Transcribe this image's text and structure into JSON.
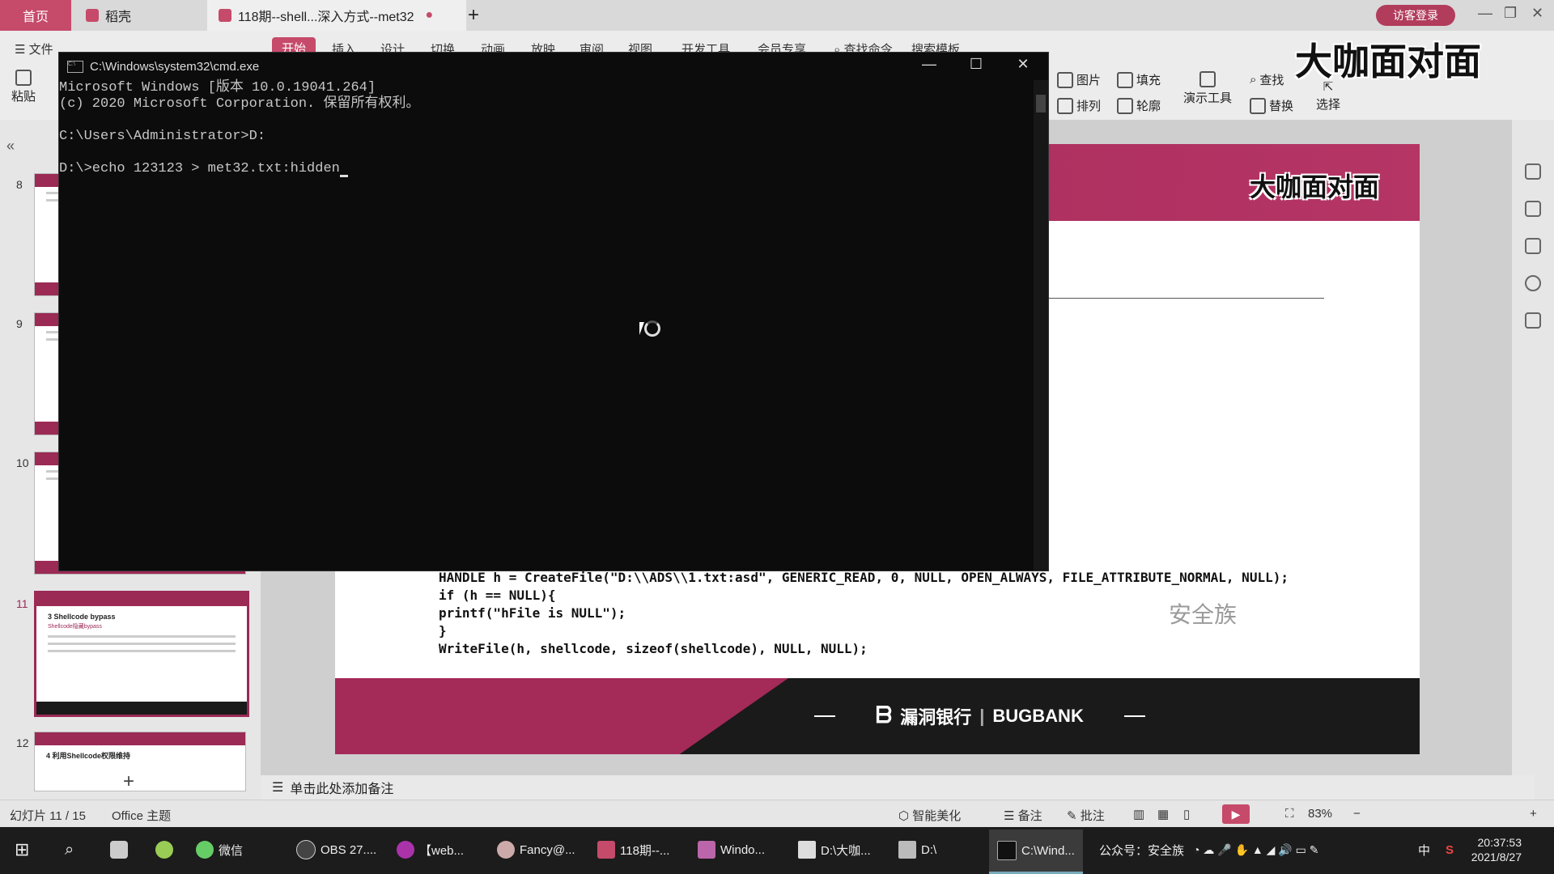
{
  "tabs": {
    "home": "稻壳",
    "home_label": "首页",
    "daoke": "稻壳",
    "doc": "118期--shell...深入方式--met32",
    "plus": "+",
    "login": "访客登录"
  },
  "ribbon": {
    "file": "文件",
    "menus": [
      "开始",
      "插入",
      "设计",
      "切换",
      "动画",
      "放映",
      "审阅",
      "视图",
      "开发工具",
      "会员专享",
      "查找命令",
      "搜索模板"
    ],
    "paste": "粘贴",
    "tools": {
      "picture": "图片",
      "fill": "填充",
      "arrange": "排列",
      "outline": "轮廓",
      "presenter": "演示工具",
      "find": "查找",
      "replace": "替换",
      "select": "选择"
    },
    "brand_stamp": "大咖面对面"
  },
  "thumbs": {
    "nums": [
      "8",
      "9",
      "10",
      "11",
      "12"
    ],
    "slide11_title": "3 Shellcode bypass",
    "slide11_sub": "Shellcode隐藏bypass",
    "slide12_title": "4 利用Shellcode权限维持",
    "add": "+"
  },
  "cmd": {
    "title": "C:\\Windows\\system32\\cmd.exe",
    "lines": [
      "Microsoft Windows [版本 10.0.19041.264]",
      "(c) 2020 Microsoft Corporation. 保留所有权利。",
      "",
      "C:\\Users\\Administrator>D:",
      "",
      "D:\\>echo 123123 > met32.txt:hidden"
    ]
  },
  "slide": {
    "header_title": "大咖面对面",
    "code": [
      "HANDLE h = CreateFile(\"D:\\\\ADS\\\\1.txt:asd\", GENERIC_READ, 0, NULL, OPEN_ALWAYS, FILE_ATTRIBUTE_NORMAL, NULL);",
      "if (h == NULL){",
      "printf(\"hFile is NULL\");",
      "}",
      "WriteFile(h, shellcode, sizeof(shellcode), NULL, NULL);"
    ],
    "watermark": "安全族",
    "footer_brand_cn": "漏洞银行",
    "footer_brand_en": "BUGBANK"
  },
  "notes": "单击此处添加备注",
  "status": {
    "slide_pos": "幻灯片 11 / 15",
    "theme": "Office 主题",
    "beautify": "智能美化",
    "notes_btn": "备注",
    "comment": "批注",
    "zoom": "83%"
  },
  "taskbar": {
    "items": [
      "微信",
      "OBS 27....",
      "【web...",
      "Fancy@...",
      "118期--...",
      "Windo...",
      "D:\\大咖...",
      "D:\\",
      "C:\\Wind..."
    ],
    "tray_text": "公众号：安全族",
    "ime": "中",
    "time": "20:37:53",
    "date": "2021/8/27"
  }
}
